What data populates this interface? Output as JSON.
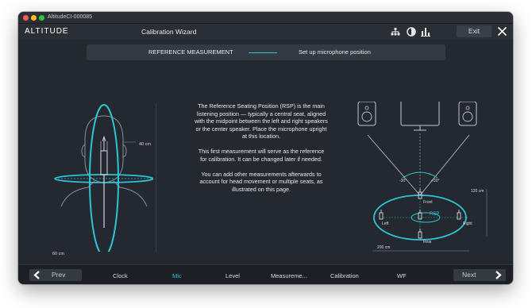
{
  "window": {
    "title": "AltitudeCI-000085"
  },
  "header": {
    "logo": "ALTITUDE",
    "title": "Calibration Wizard",
    "exit_label": "Exit",
    "icons": [
      "network-icon",
      "half-moon-icon",
      "bar-chart-icon",
      "close-icon"
    ]
  },
  "banner": {
    "step": "REFERENCE MEASUREMENT",
    "instruction": "Set up microphone position"
  },
  "head_diagram": {
    "height_label": "40 cm",
    "width_label": "60 cm"
  },
  "description": {
    "p1": "The Reference Seating Position (RSP) is the main listening position — typically a central seat, aligned with the midpoint between the left and right speakers or the center speaker. Place the microphone upright at this location.",
    "p2": "This first measurement will serve as the reference for calibration. It can be changed later if needed.",
    "p3": "You can add other measurements afterwards to account for head movement or multiple seats, as illustrated on this page."
  },
  "room_diagram": {
    "angle_left": "-30°",
    "angle_right": "+30°",
    "front": "Front",
    "left": "Left",
    "right": "Right",
    "rear": "Rear",
    "rsp": "RSP",
    "depth": "120 cm",
    "width": "200 cm"
  },
  "footer": {
    "prev": "Prev",
    "next": "Next",
    "steps": [
      "Clock",
      "Mic",
      "Level",
      "Measureme...",
      "Calibration",
      "WF"
    ],
    "active_step": "Mic"
  },
  "colors": {
    "accent": "#2ec4d6",
    "background": "#24282f"
  }
}
